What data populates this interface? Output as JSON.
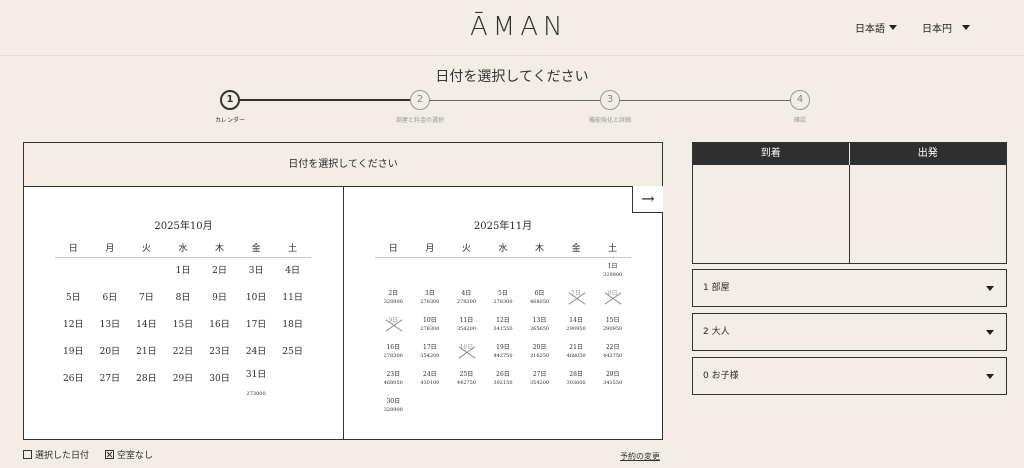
{
  "header": {
    "logo": "ĀMAN",
    "language": "日本語",
    "currency": "日本円"
  },
  "title": "日付を選択してください",
  "steps": [
    {
      "num": "1",
      "label": "カレンダー"
    },
    {
      "num": "2",
      "label": "部屋と料金の選択"
    },
    {
      "num": "3",
      "label": "機能強化と詳細"
    },
    {
      "num": "4",
      "label": "確認"
    }
  ],
  "calendar": {
    "header": "日付を選択してください",
    "next_icon": "→",
    "weekdays": [
      "日",
      "月",
      "火",
      "水",
      "木",
      "金",
      "土"
    ],
    "months": [
      {
        "title": "2025年10月",
        "weeks": [
          [
            {
              "d": ""
            },
            {
              "d": ""
            },
            {
              "d": ""
            },
            {
              "d": "1日"
            },
            {
              "d": "2日"
            },
            {
              "d": "3日"
            },
            {
              "d": "4日"
            }
          ],
          [
            {
              "d": "5日"
            },
            {
              "d": "6日"
            },
            {
              "d": "7日"
            },
            {
              "d": "8日"
            },
            {
              "d": "9日"
            },
            {
              "d": "10日"
            },
            {
              "d": "11日"
            }
          ],
          [
            {
              "d": "12日"
            },
            {
              "d": "13日"
            },
            {
              "d": "14日"
            },
            {
              "d": "15日"
            },
            {
              "d": "16日"
            },
            {
              "d": "17日"
            },
            {
              "d": "18日"
            }
          ],
          [
            {
              "d": "19日"
            },
            {
              "d": "20日"
            },
            {
              "d": "21日"
            },
            {
              "d": "22日"
            },
            {
              "d": "23日"
            },
            {
              "d": "24日"
            },
            {
              "d": "25日"
            }
          ],
          [
            {
              "d": "26日"
            },
            {
              "d": "27日"
            },
            {
              "d": "28日"
            },
            {
              "d": "29日"
            },
            {
              "d": "30日"
            },
            {
              "d": "31日",
              "p": "273000"
            },
            {
              "d": ""
            }
          ]
        ]
      },
      {
        "title": "2025年11月",
        "weeks": [
          [
            {
              "d": ""
            },
            {
              "d": ""
            },
            {
              "d": ""
            },
            {
              "d": ""
            },
            {
              "d": ""
            },
            {
              "d": ""
            },
            {
              "d": "1日",
              "p": "328900"
            }
          ],
          [
            {
              "d": "2日",
              "p": "328900"
            },
            {
              "d": "3日",
              "p": "278300"
            },
            {
              "d": "4日",
              "p": "278300"
            },
            {
              "d": "5日",
              "p": "278300"
            },
            {
              "d": "6日",
              "p": "468050"
            },
            {
              "d": "7日",
              "na": true
            },
            {
              "d": "8日",
              "na": true
            }
          ],
          [
            {
              "d": "9日",
              "na": true
            },
            {
              "d": "10日",
              "p": "278300"
            },
            {
              "d": "11日",
              "p": "354200"
            },
            {
              "d": "12日",
              "p": "341550"
            },
            {
              "d": "13日",
              "p": "265650"
            },
            {
              "d": "14日",
              "p": "290950"
            },
            {
              "d": "15日",
              "p": "290950"
            }
          ],
          [
            {
              "d": "16日",
              "p": "278300"
            },
            {
              "d": "17日",
              "p": "354200"
            },
            {
              "d": "18日",
              "na": true
            },
            {
              "d": "19日",
              "p": "442750"
            },
            {
              "d": "20日",
              "p": "316250"
            },
            {
              "d": "21日",
              "p": "468050"
            },
            {
              "d": "22日",
              "p": "442750"
            }
          ],
          [
            {
              "d": "23日",
              "p": "468050"
            },
            {
              "d": "24日",
              "p": "430100"
            },
            {
              "d": "25日",
              "p": "442750"
            },
            {
              "d": "26日",
              "p": "392150"
            },
            {
              "d": "27日",
              "p": "354200"
            },
            {
              "d": "28日",
              "p": "303600"
            },
            {
              "d": "29日",
              "p": "341550"
            }
          ],
          [
            {
              "d": "30日",
              "p": "328900"
            },
            {
              "d": ""
            },
            {
              "d": ""
            },
            {
              "d": ""
            },
            {
              "d": ""
            },
            {
              "d": ""
            },
            {
              "d": ""
            }
          ]
        ]
      }
    ]
  },
  "booking": {
    "arrival": "到着",
    "departure": "出発",
    "rooms": "1 部屋",
    "adults": "2 大人",
    "children": "0 お子様"
  },
  "legend": {
    "selected": "選択した日付",
    "unavailable": "空室なし",
    "change_link": "予約の変更"
  }
}
